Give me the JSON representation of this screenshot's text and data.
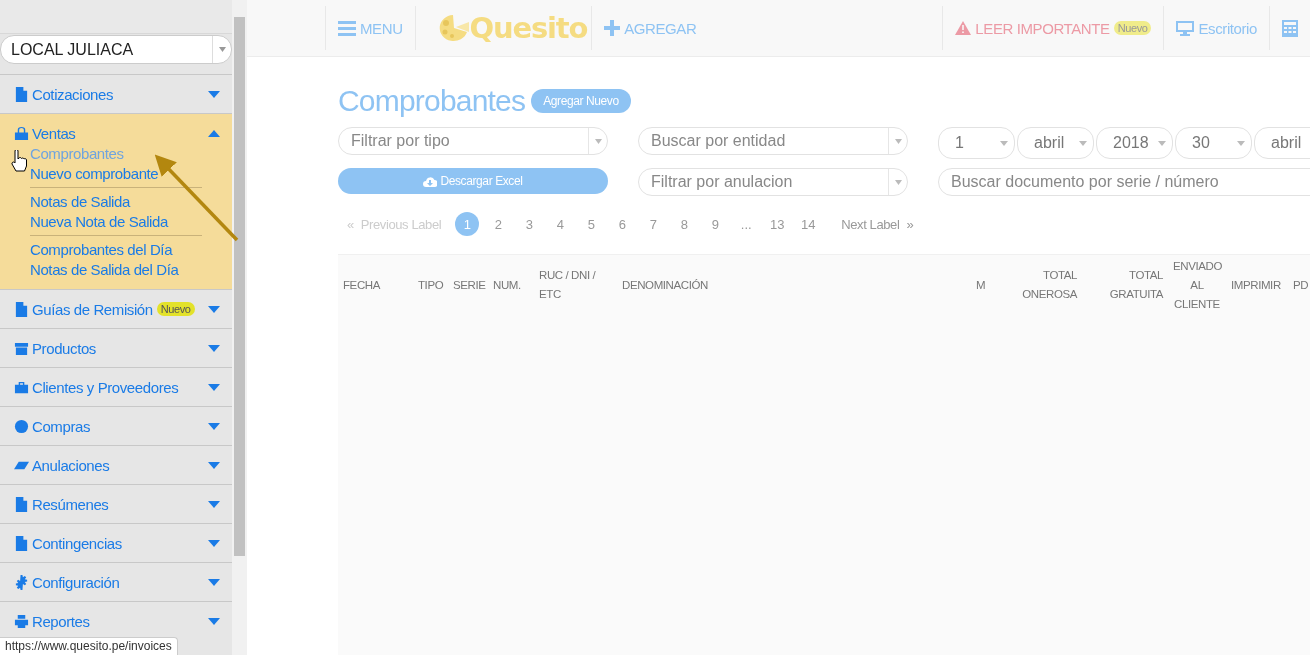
{
  "store_select": {
    "value": "LOCAL JULIACA"
  },
  "sidebar": {
    "items": [
      {
        "label": "Cotizaciones",
        "expanded": false
      },
      {
        "label": "Ventas",
        "expanded": true,
        "sections": [
          {
            "links": [
              {
                "label": "Comprobantes",
                "hovered": true
              },
              {
                "label": "Nuevo comprobante",
                "hovered": false
              }
            ]
          },
          {
            "links": [
              {
                "label": "Notas de Salida",
                "hovered": false
              },
              {
                "label": "Nueva Nota de Salida",
                "hovered": false
              }
            ]
          },
          {
            "links": [
              {
                "label": "Comprobantes del Día",
                "hovered": false
              },
              {
                "label": "Notas de Salida del Día",
                "hovered": false
              }
            ]
          }
        ]
      },
      {
        "label": "Guías de Remisión",
        "expanded": false,
        "badge": "Nuevo"
      },
      {
        "label": "Productos",
        "expanded": false
      },
      {
        "label": "Clientes y Proveedores",
        "expanded": false
      },
      {
        "label": "Compras",
        "expanded": false
      },
      {
        "label": "Anulaciones",
        "expanded": false
      },
      {
        "label": "Resúmenes",
        "expanded": false
      },
      {
        "label": "Contingencias",
        "expanded": false
      },
      {
        "label": "Configuración",
        "expanded": false
      },
      {
        "label": "Reportes",
        "expanded": false
      }
    ]
  },
  "status_url": "https://www.quesito.pe/invoices",
  "topbar": {
    "menu": "MENU",
    "logo": "Quesito",
    "add": "AGREGAR",
    "important": "LEER IMPORTANTE",
    "important_badge": "Nuevo",
    "desktop": "Escritorio"
  },
  "page": {
    "title": "Comprobantes",
    "add_button": "Agregar Nuevo"
  },
  "filters": {
    "type": {
      "placeholder": "Filtrar por tipo"
    },
    "entity": {
      "placeholder": "Buscar por entidad"
    },
    "dates": [
      {
        "value": "1"
      },
      {
        "value": "abril"
      },
      {
        "value": "2018"
      },
      {
        "value": "30"
      },
      {
        "value": "abril"
      }
    ],
    "excel_button": "Descargar Excel",
    "annulment": {
      "placeholder": "Filtrar por anulacion"
    },
    "search": {
      "placeholder": "Buscar documento por serie / número"
    }
  },
  "pagination": {
    "prev": {
      "arrow": "«",
      "label": "Previous Label",
      "disabled": true
    },
    "pages": [
      {
        "label": "1",
        "selected": true
      },
      {
        "label": "2",
        "selected": false
      },
      {
        "label": "3",
        "selected": false
      },
      {
        "label": "4",
        "selected": false
      },
      {
        "label": "5",
        "selected": false
      },
      {
        "label": "6",
        "selected": false
      },
      {
        "label": "7",
        "selected": false
      },
      {
        "label": "8",
        "selected": false
      },
      {
        "label": "9",
        "selected": false
      },
      {
        "label": "...",
        "selected": false
      },
      {
        "label": "13",
        "selected": false
      },
      {
        "label": "14",
        "selected": false
      }
    ],
    "next": {
      "label": "Next Label",
      "arrow": "»",
      "disabled": false
    }
  },
  "table": {
    "columns": [
      "FECHA",
      "TIPO",
      "SERIE",
      "NUM.",
      "RUC / DNI / ETC",
      "DENOMINACIÓN",
      "M",
      "TOTAL ONEROSA",
      "TOTAL GRATUITA",
      "ENVIADO AL CLIENTE",
      "IMPRIMIR",
      "PD"
    ]
  }
}
